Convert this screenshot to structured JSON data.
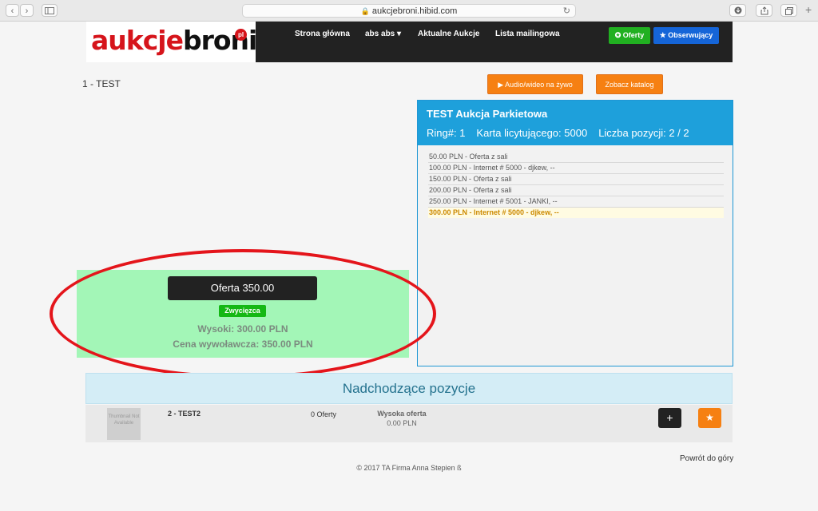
{
  "browser": {
    "url": "aukcjebroni.hibid.com",
    "back_glyph": "‹",
    "forward_glyph": "›"
  },
  "logo": {
    "part1": "aukcje",
    "part2": "broni",
    "badge": "pl"
  },
  "nav": {
    "items": [
      "Strona główna",
      "abs abs ▾",
      "Aktualne Aukcje",
      "Lista mailingowa"
    ],
    "oferty_label": "✪ Oferty",
    "obserwujacy_label": "★ Obserwujący"
  },
  "lot": {
    "title": "1 - TEST"
  },
  "actions": {
    "audio_video": "▶ Audio/wideo na żywo",
    "catalog": "Zobacz katalog"
  },
  "ring": {
    "title": "TEST Aukcja Parkietowa",
    "ring": "Ring#: 1",
    "bidder_card": "Karta licytującego: 5000",
    "lot_count": "Liczba pozycji: 2 / 2",
    "bids": [
      "50.00 PLN - Oferta z sali",
      "100.00 PLN - Internet # 5000 - djkew, --",
      "150.00 PLN - Oferta z sali",
      "200.00 PLN - Oferta z sali",
      "250.00 PLN - Internet # 5001 - JANKI, --",
      "300.00 PLN - Internet # 5000 - djkew, --"
    ]
  },
  "bidbox": {
    "button": "Oferta 350.00",
    "status": "Zwycięzca",
    "high": "Wysoki: 300.00 PLN",
    "asking": "Cena wywoławcza: 350.00 PLN"
  },
  "upcoming": {
    "heading": "Nadchodzące pozycje",
    "thumbnail": "Thumbnail Not Available",
    "lot": "2 - TEST2",
    "bids": "0 Oferty",
    "high_label": "Wysoka oferta",
    "high_value": "0.00 PLN",
    "plus_glyph": "+",
    "star_glyph": "★"
  },
  "footer": {
    "back_to_top": "Powrót do góry",
    "copyright": "© 2017 TA Firma Anna Stepien ß"
  },
  "colors": {
    "brand_red": "#d6141b",
    "orange": "#f68012",
    "ring_blue": "#1ea0db",
    "winner_green": "#14b814"
  }
}
